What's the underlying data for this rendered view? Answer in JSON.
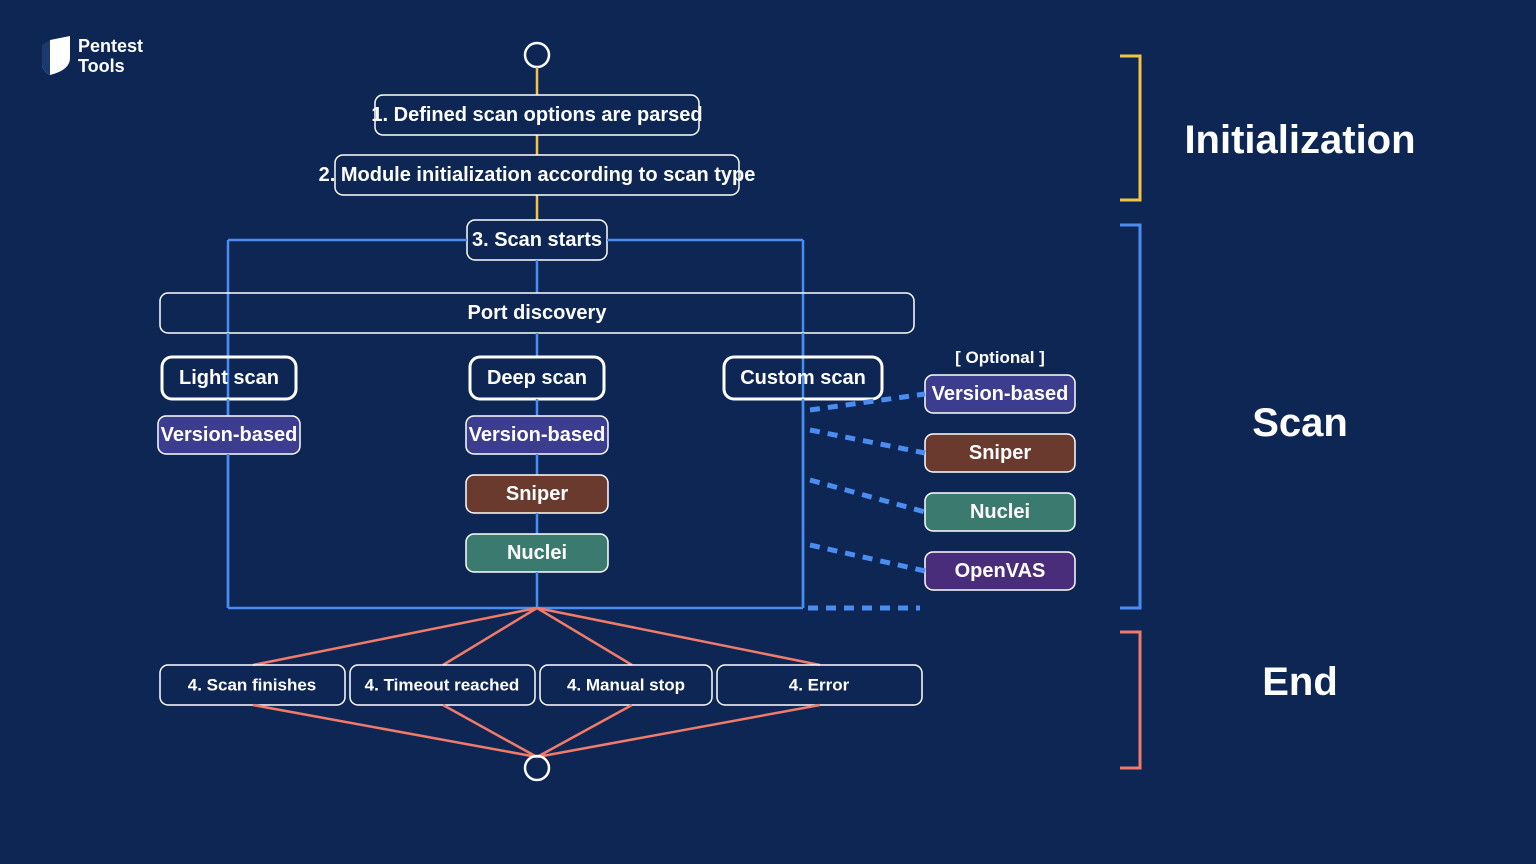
{
  "logo": {
    "line1": "Pentest",
    "line2": "Tools"
  },
  "sections": {
    "init": "Initialization",
    "scan": "Scan",
    "end": "End"
  },
  "steps": {
    "s1": "1.  Defined scan options are parsed",
    "s2": "2.  Module initialization according to scan type",
    "s3": "3.  Scan starts",
    "port": "Port discovery",
    "light": "Light scan",
    "deep": "Deep scan",
    "custom": "Custom scan",
    "optional": "[ Optional ]",
    "finish": "4.  Scan finishes",
    "timeout": "4.  Timeout reached",
    "manual": "4.  Manual stop",
    "error": "4.  Error"
  },
  "modules": {
    "version": "Version-based",
    "sniper": "Sniper",
    "nuclei": "Nuclei",
    "openvas": "OpenVAS"
  },
  "colors": {
    "bg": "#0d2654",
    "yellow": "#f3c442",
    "blue": "#4a8cf0",
    "salmon": "#f07b6a",
    "purple": "#3d3d8f",
    "brown": "#6b3a2e",
    "teal": "#3b7a6e",
    "violet": "#4a2d7a"
  }
}
